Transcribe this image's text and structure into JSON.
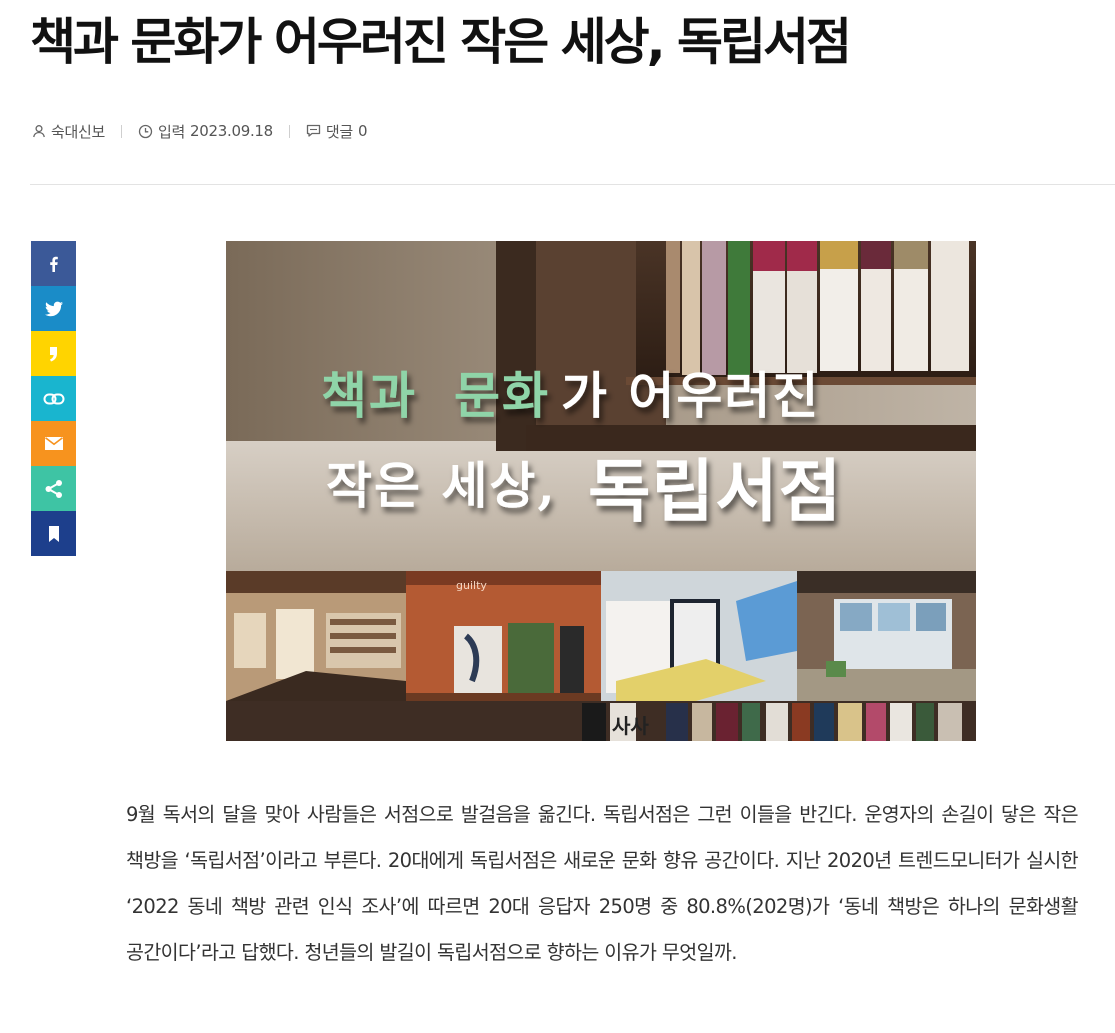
{
  "article": {
    "title": "책과 문화가 어우러진 작은 세상, 독립서점",
    "meta": {
      "author": "숙대신보",
      "date_label": "입력",
      "date": "2023.09.18",
      "comments_label": "댓글",
      "comments_count": "0"
    },
    "body": "9월 독서의 달을 맞아 사람들은 서점으로 발걸음을 옮긴다. 독립서점은 그런 이들을 반긴다. 운영자의 손길이 닿은 작은 책방을 ‘독립서점’이라고 부른다. 20대에게 독립서점은 새로운 문화 향유 공간이다. 지난 2020년 트렌드모니터가 실시한 ‘2022 동네 책방 관련 인식 조사’에 따르면 20대 응답자 250명 중 80.8%(202명)가 ‘동네 책방은 하나의 문화생활 공간이다’라고 답했다. 청년들의 발길이 독립서점으로 향하는 이유가 무엇일까."
  },
  "hero_image": {
    "caption_line1_part1": "책과",
    "caption_line1_part2": "문화",
    "caption_line1_part3": "가 어우러진",
    "caption_line2_part1": "작은 세상,",
    "caption_line2_part2": "독립서점",
    "shelf_tag": "guilty",
    "spine_text": "사사"
  },
  "share_buttons": [
    {
      "name": "facebook",
      "color": "#3b5998",
      "icon": "facebook-icon"
    },
    {
      "name": "twitter",
      "color": "#1a8cc8",
      "icon": "twitter-icon"
    },
    {
      "name": "kakaostory",
      "color": "#ffd400",
      "icon": "kakaostory-icon"
    },
    {
      "name": "link",
      "color": "#19b5cf",
      "icon": "link-icon"
    },
    {
      "name": "email",
      "color": "#f7931e",
      "icon": "email-icon"
    },
    {
      "name": "share",
      "color": "#3ec4a4",
      "icon": "share-icon"
    },
    {
      "name": "bookmark",
      "color": "#1d3f8c",
      "icon": "bookmark-icon"
    }
  ]
}
